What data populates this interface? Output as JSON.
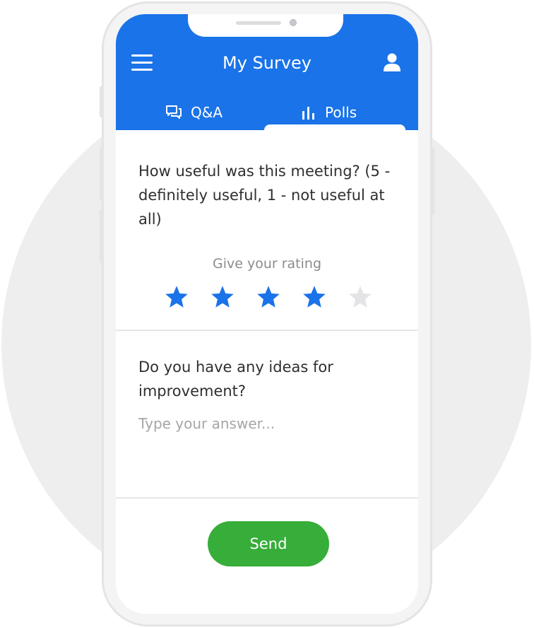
{
  "app": {
    "title": "My Survey"
  },
  "tabs": [
    {
      "label": "Q&A",
      "icon": "chat-bubbles-icon",
      "active": false
    },
    {
      "label": "Polls",
      "icon": "bar-chart-icon",
      "active": true
    }
  ],
  "questions": [
    {
      "text": "How useful was this meeting? (5 - definitely useful, 1 - not useful at all)",
      "rating_label": "Give your rating",
      "rating": 4,
      "max_rating": 5
    },
    {
      "text": "Do you have any ideas for improvement?",
      "answer_value": "",
      "answer_placeholder": "Type your answer..."
    }
  ],
  "send": {
    "label": "Send"
  },
  "colors": {
    "header": "#1a73e8",
    "star_filled": "#1a73e8",
    "star_empty": "#e4e4e6",
    "send_button": "#37ad3a"
  }
}
